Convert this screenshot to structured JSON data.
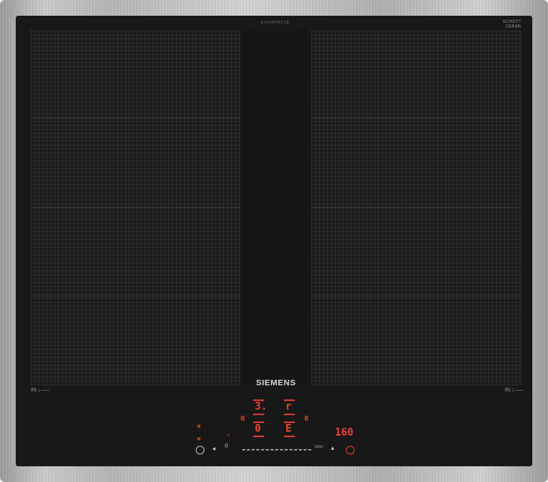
{
  "model_label": "EX645HXC1E",
  "badge": {
    "line1": "SCHOTT",
    "line2": "CERAN"
  },
  "brand": "SIEMENS",
  "zone_marks": {
    "left": "IN  ↓⸺",
    "right": "IN  ↓⸺"
  },
  "displays": {
    "left_top": "3.",
    "left_top_sub": "",
    "right_top": "r",
    "left_bottom": "0",
    "right_bottom": "E",
    "timer": "160"
  },
  "slider_end_label": "0000",
  "colors": {
    "glass": "#181818",
    "display_red": "#e8432f",
    "frame": "#bdbdbd"
  },
  "icons": [
    "power-icon",
    "lock-icon",
    "minus-icon",
    "plus-icon",
    "timer-icon",
    "alarm-icon"
  ]
}
